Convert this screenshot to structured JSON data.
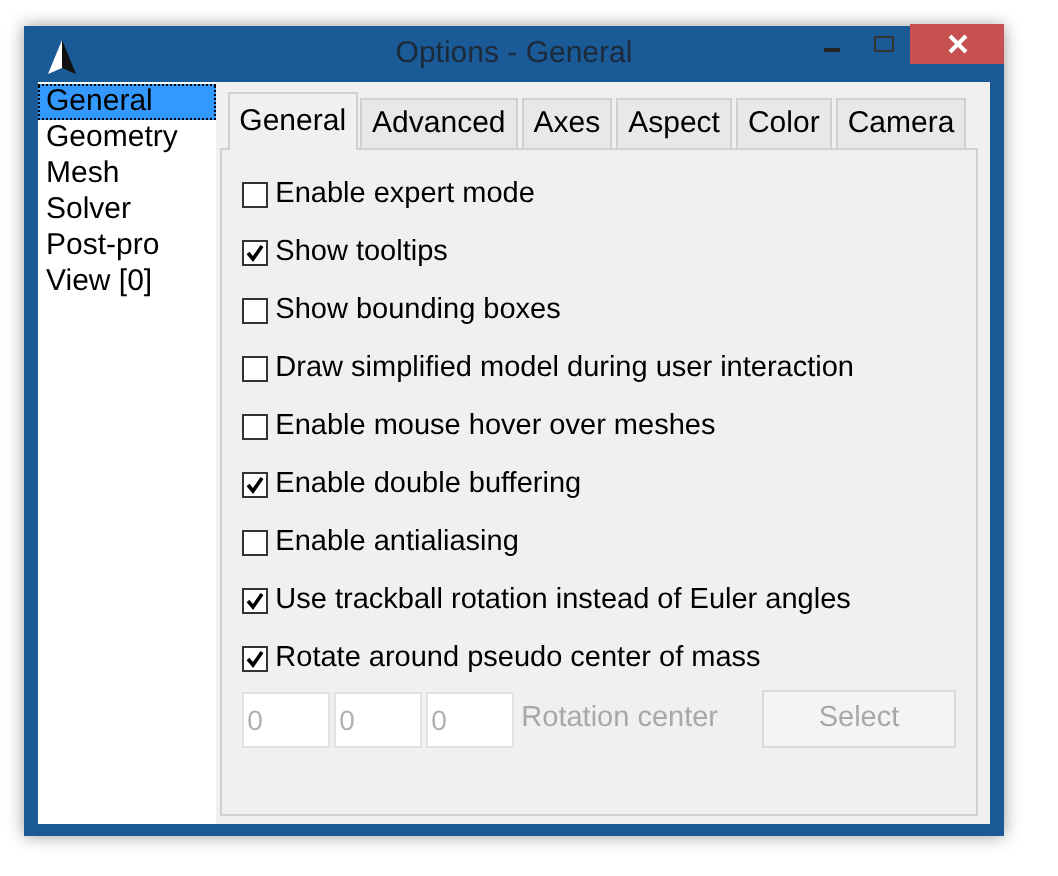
{
  "window": {
    "title": "Options - General"
  },
  "sidebar": {
    "items": [
      {
        "label": "General",
        "selected": true
      },
      {
        "label": "Geometry",
        "selected": false
      },
      {
        "label": "Mesh",
        "selected": false
      },
      {
        "label": "Solver",
        "selected": false
      },
      {
        "label": "Post-pro",
        "selected": false
      },
      {
        "label": "View [0]",
        "selected": false
      }
    ]
  },
  "tabs": [
    {
      "label": "General",
      "selected": true
    },
    {
      "label": "Advanced",
      "selected": false
    },
    {
      "label": "Axes",
      "selected": false
    },
    {
      "label": "Aspect",
      "selected": false
    },
    {
      "label": "Color",
      "selected": false
    },
    {
      "label": "Camera",
      "selected": false
    }
  ],
  "options": [
    {
      "label": "Enable expert mode",
      "checked": false
    },
    {
      "label": "Show tooltips",
      "checked": true
    },
    {
      "label": "Show bounding boxes",
      "checked": false
    },
    {
      "label": "Draw simplified model during user interaction",
      "checked": false
    },
    {
      "label": "Enable mouse hover over meshes",
      "checked": false
    },
    {
      "label": "Enable double buffering",
      "checked": true
    },
    {
      "label": "Enable antialiasing",
      "checked": false
    },
    {
      "label": "Use trackball rotation instead of Euler angles",
      "checked": true
    },
    {
      "label": "Rotate around pseudo center of mass",
      "checked": true
    }
  ],
  "rotation_center": {
    "fields": [
      "0",
      "0",
      "0"
    ],
    "label": "Rotation center",
    "button": "Select",
    "disabled": true
  }
}
